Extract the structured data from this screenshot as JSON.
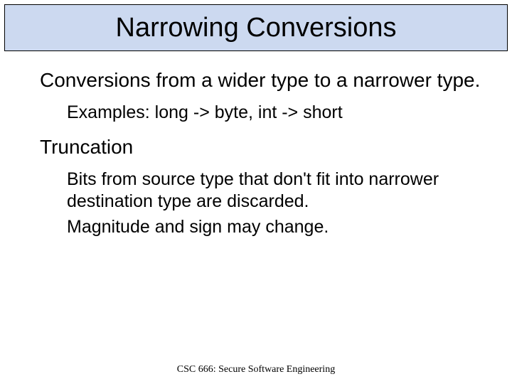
{
  "title": "Narrowing Conversions",
  "body": {
    "intro": "Conversions from a wider type to a narrower type.",
    "examples": "Examples: long -> byte, int -> short",
    "heading": "Truncation",
    "detail1": "Bits from source type that don't fit into narrower destination type are discarded.",
    "detail2": "Magnitude and sign may change."
  },
  "footer": "CSC 666: Secure Software Engineering"
}
